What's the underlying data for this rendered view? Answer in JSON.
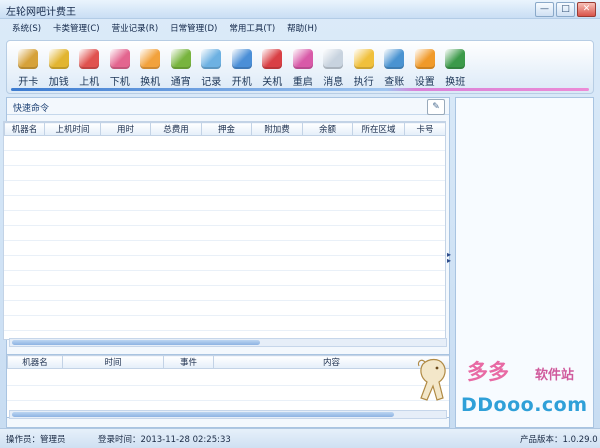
{
  "window": {
    "title": "左轮网吧计费王",
    "minimize": "—",
    "maximize": "□",
    "close": "✕"
  },
  "menu": [
    "系统(S)",
    "卡类管理(C)",
    "营业记录(R)",
    "日常管理(D)",
    "常用工具(T)",
    "帮助(H)"
  ],
  "toolbar": [
    {
      "label": "开卡",
      "icon": "card-open-icon",
      "color": "#d6a23a"
    },
    {
      "label": "加钱",
      "icon": "money-add-icon",
      "color": "#e2b531"
    },
    {
      "label": "上机",
      "icon": "login-icon",
      "color": "#e0524f"
    },
    {
      "label": "下机",
      "icon": "logout-icon",
      "color": "#e3658f"
    },
    {
      "label": "换机",
      "icon": "swap-machine-icon",
      "color": "#f2a23c"
    },
    {
      "label": "通宵",
      "icon": "overnight-icon",
      "color": "#78b43e"
    },
    {
      "label": "记录",
      "icon": "record-icon",
      "color": "#6db1e2"
    },
    {
      "label": "开机",
      "icon": "power-on-icon",
      "color": "#4b8fd7"
    },
    {
      "label": "关机",
      "icon": "power-off-icon",
      "color": "#d94045"
    },
    {
      "label": "重启",
      "icon": "restart-icon",
      "color": "#d85aa8"
    },
    {
      "label": "消息",
      "icon": "message-icon",
      "color": "#c8d3df"
    },
    {
      "label": "执行",
      "icon": "execute-icon",
      "color": "#f0c03c"
    },
    {
      "label": "查账",
      "icon": "audit-icon",
      "color": "#4a93d1"
    },
    {
      "label": "设置",
      "icon": "settings-gear-icon",
      "color": "#f09a2a"
    },
    {
      "label": "换班",
      "icon": "shift-change-icon",
      "color": "#3c9a4a"
    }
  ],
  "quick": {
    "label": "快速命令"
  },
  "main_table": {
    "columns": [
      "机器名",
      "上机时间",
      "用时",
      "总费用",
      "押金",
      "附加费",
      "余额",
      "所在区域",
      "卡号"
    ]
  },
  "events_table": {
    "columns": [
      "机器名",
      "时间",
      "事件",
      "内容"
    ]
  },
  "status": {
    "operator": "操作员：管理员",
    "login_time": "登录时间：2013-11-28 02:25:33",
    "version": "产品版本：1.0.29.0"
  },
  "watermark": {
    "brand_cn": "多多",
    "brand_cn2": "软件站",
    "brand_en": "DDooo.com"
  },
  "colors": {
    "accent": "#3c7bd0",
    "accent_pink": "#ec8bd6"
  }
}
